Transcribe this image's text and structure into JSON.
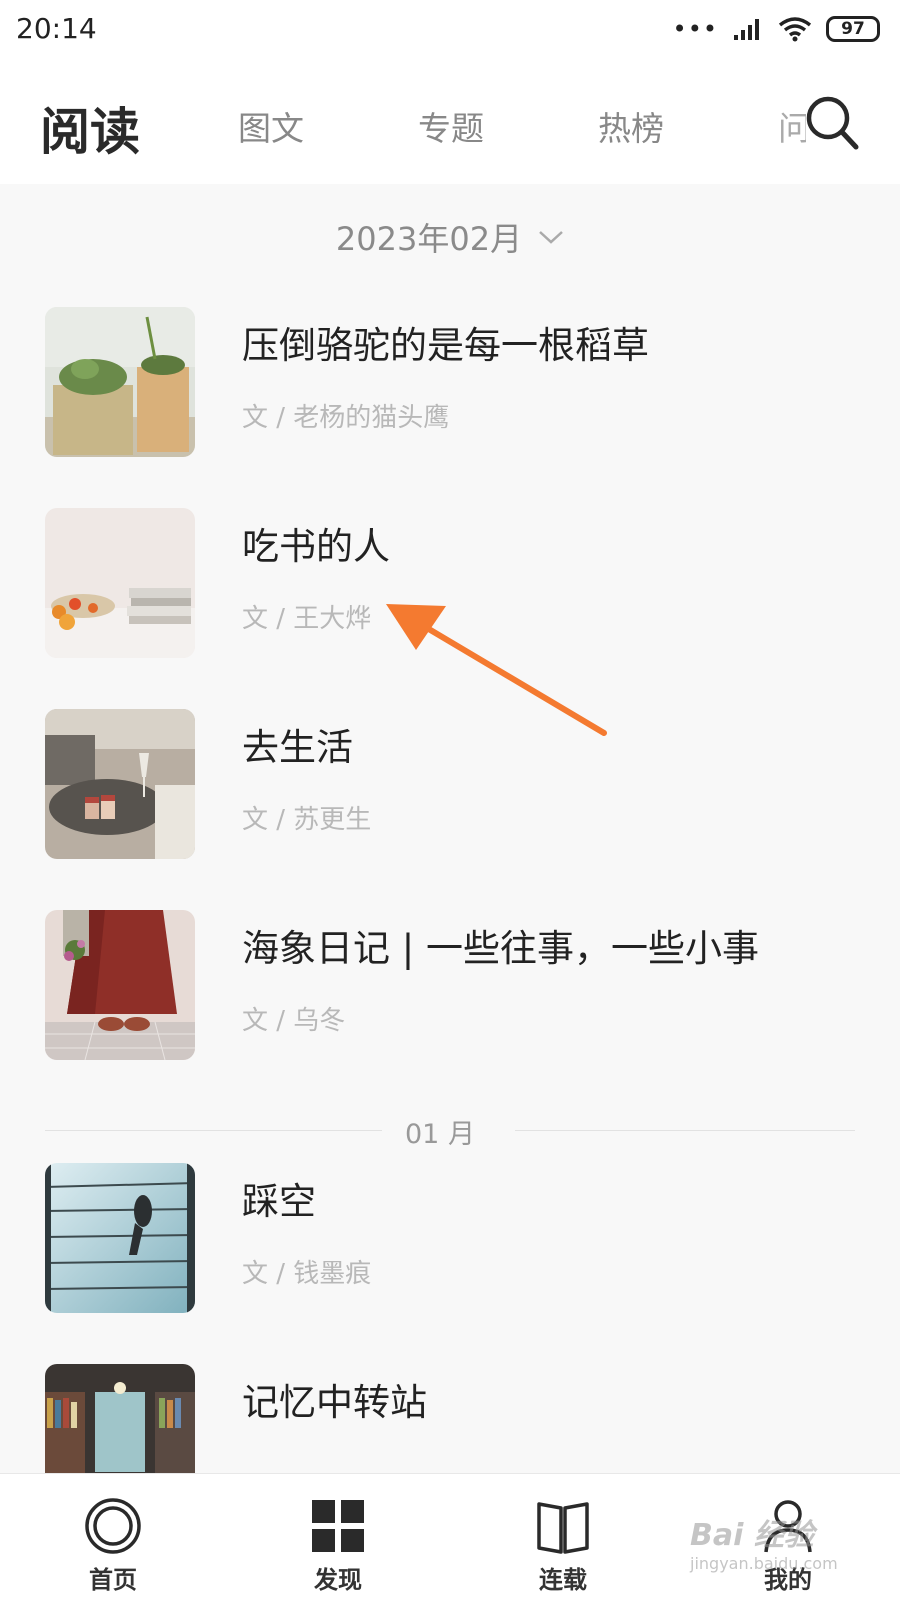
{
  "status_bar": {
    "time": "20:14",
    "signal_dots": "•••",
    "battery": "97"
  },
  "top_nav": {
    "title": "阅读",
    "tabs": [
      "图文",
      "专题",
      "热榜",
      "问"
    ]
  },
  "month_selector": {
    "label": "2023年02月"
  },
  "articles": [
    {
      "title": "压倒骆驼的是每一根稻草",
      "author": "文 / 老杨的猫头鹰"
    },
    {
      "title": "吃书的人",
      "author": "文 / 王大烨"
    },
    {
      "title": "去生活",
      "author": "文 / 苏更生"
    },
    {
      "title": "海象日记 | 一些往事，一些小事",
      "author": "文 / 乌冬"
    },
    {
      "title": "踩空",
      "author": "文 / 钱墨痕"
    },
    {
      "title": "记忆中转站",
      "author": ""
    }
  ],
  "section_divider": {
    "label": "01 月"
  },
  "bottom_nav": {
    "items": [
      "首页",
      "发现",
      "连载",
      "我的"
    ]
  },
  "watermark": {
    "brand": "Bai 经验",
    "url": "jingyan.baidu.com"
  },
  "colors": {
    "arrow": "#f47a30",
    "background": "#f8f8f8"
  }
}
